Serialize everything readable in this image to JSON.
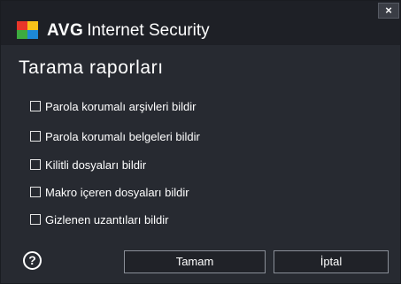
{
  "window": {
    "brand": "AVG",
    "product": "Internet Security",
    "close_icon": "×"
  },
  "heading": "Tarama raporları",
  "options": [
    {
      "label": "Parola korumalı arşivleri bildir",
      "checked": false
    },
    {
      "label": "Parola korumalı belgeleri bildir",
      "checked": false
    },
    {
      "label": "Kilitli dosyaları bildir",
      "checked": false
    },
    {
      "label": "Makro içeren dosyaları bildir",
      "checked": false
    },
    {
      "label": "Gizlenen uzantıları bildir",
      "checked": false
    }
  ],
  "footer": {
    "help_icon": "?",
    "ok_label": "Tamam",
    "cancel_label": "İptal"
  },
  "colors": {
    "background": "#272a31",
    "titlebar": "#1e2026",
    "text": "#ffffff",
    "logo_red": "#e8362a",
    "logo_yellow": "#f7c21a",
    "logo_green": "#3dab3f",
    "logo_blue": "#1d88d6"
  }
}
